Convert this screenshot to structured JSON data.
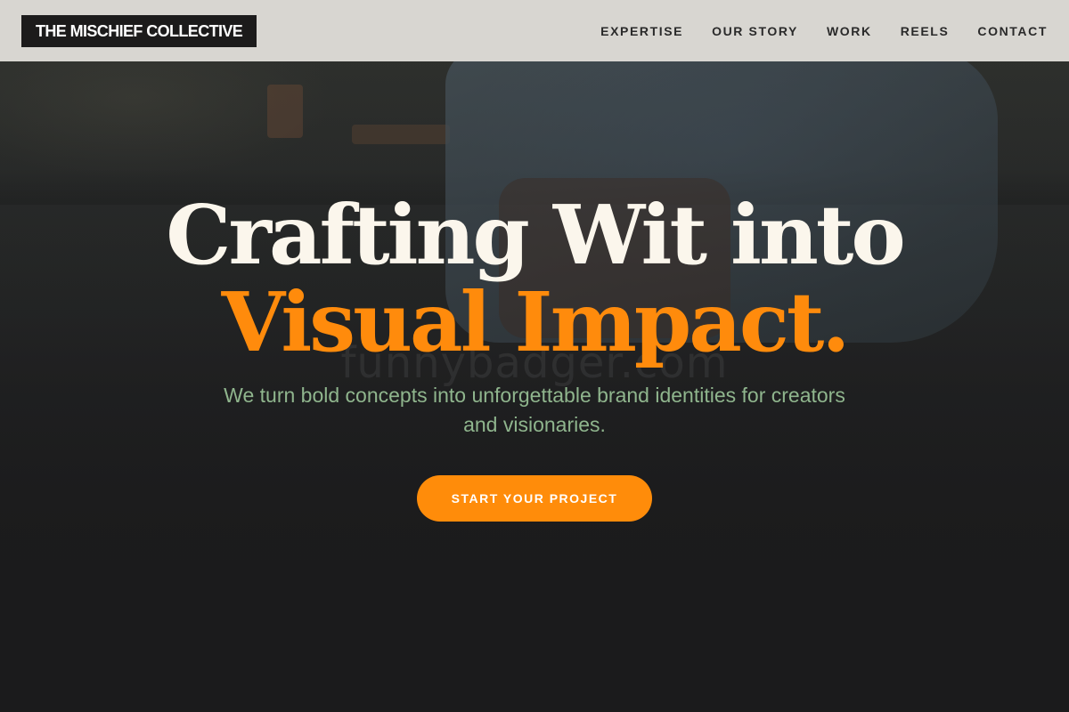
{
  "header": {
    "logo_text": "THE MISCHIEF COLLECTIVE",
    "nav": [
      {
        "label": "EXPERTISE"
      },
      {
        "label": "OUR STORY"
      },
      {
        "label": "WORK"
      },
      {
        "label": "REELS"
      },
      {
        "label": "CONTACT"
      }
    ]
  },
  "hero": {
    "title_line1": "Crafting Wit into",
    "title_line2": "Visual Impact.",
    "subtitle": "We turn bold concepts into unforgettable brand identities for creators and visionaries.",
    "cta_label": "START YOUR PROJECT",
    "background_watermark": "funnybadger.com"
  },
  "colors": {
    "accent": "#ff8b0c",
    "header_bg": "#d8d6d1",
    "logo_bg": "#1c1b1b",
    "title_light": "#fbf6ec",
    "subtitle": "#8fb58d",
    "page_bg": "#1b1b1c"
  }
}
